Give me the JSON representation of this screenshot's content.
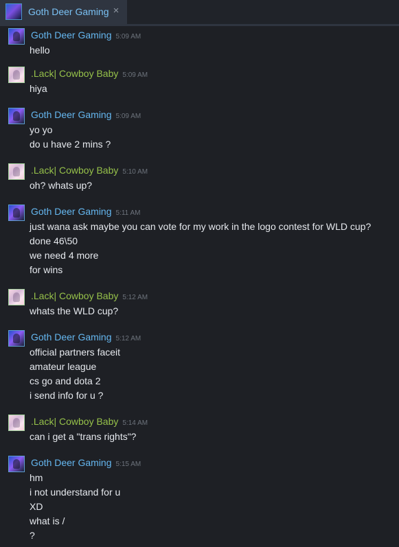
{
  "tab": {
    "title": "Goth Deer Gaming",
    "close_symbol": "×"
  },
  "messages": [
    {
      "author": "Goth Deer Gaming",
      "timestamp": "5:09 AM",
      "lines": [
        "hello"
      ]
    },
    {
      "author": ".Lack| Cowboy Baby",
      "timestamp": "5:09 AM",
      "lines": [
        "hiya"
      ]
    },
    {
      "author": "Goth Deer Gaming",
      "timestamp": "5:09 AM",
      "lines": [
        "yo yo",
        "do u have 2 mins ?"
      ]
    },
    {
      "author": ".Lack| Cowboy Baby",
      "timestamp": "5:10 AM",
      "lines": [
        "oh? whats up?"
      ]
    },
    {
      "author": "Goth Deer Gaming",
      "timestamp": "5:11 AM",
      "lines": [
        "just wana ask maybe you can vote for my work in the logo contest for WLD cup?",
        "done 46\\50",
        "we need 4 more",
        "for wins"
      ]
    },
    {
      "author": ".Lack| Cowboy Baby",
      "timestamp": "5:12 AM",
      "lines": [
        "whats the WLD cup?"
      ]
    },
    {
      "author": "Goth Deer Gaming",
      "timestamp": "5:12 AM",
      "lines": [
        "official partners faceit",
        "amateur league",
        "cs go and dota 2",
        "i send info for u ?"
      ]
    },
    {
      "author": ".Lack| Cowboy Baby",
      "timestamp": "5:14 AM",
      "lines": [
        "can i get a \"trans rights\"?"
      ]
    },
    {
      "author": "Goth Deer Gaming",
      "timestamp": "5:15 AM",
      "lines": [
        "hm",
        "i not understand for u",
        "XD",
        "what is /",
        "?"
      ]
    }
  ]
}
